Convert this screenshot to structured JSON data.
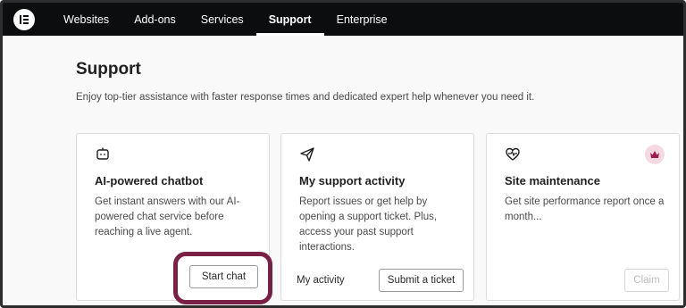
{
  "nav": {
    "items": [
      {
        "label": "Websites"
      },
      {
        "label": "Add-ons"
      },
      {
        "label": "Services"
      },
      {
        "label": "Support",
        "active": true
      },
      {
        "label": "Enterprise"
      }
    ]
  },
  "page": {
    "title": "Support",
    "subtitle": "Enjoy top-tier assistance with faster response times and dedicated expert help whenever you need it."
  },
  "cards": [
    {
      "icon": "chatbot-icon",
      "title": "AI-powered chatbot",
      "description": "Get instant answers with our AI-powered chat service before reaching a live agent.",
      "primary_button": "Start chat"
    },
    {
      "icon": "paper-plane-icon",
      "title": "My support activity",
      "description": "Report issues or get help by opening a support ticket. Plus, access your past support interactions.",
      "link_button": "My activity",
      "primary_button": "Submit a ticket"
    },
    {
      "icon": "heart-pulse-icon",
      "badge_icon": "crown-icon",
      "title": "Site maintenance",
      "description": "Get site performance report once a month...",
      "primary_button": "Claim",
      "primary_disabled": true
    }
  ],
  "colors": {
    "nav_bg": "#0c0d0e",
    "highlight": "#7a1f45",
    "badge_bg": "#f5d9e2",
    "crown": "#9c1c4d"
  }
}
